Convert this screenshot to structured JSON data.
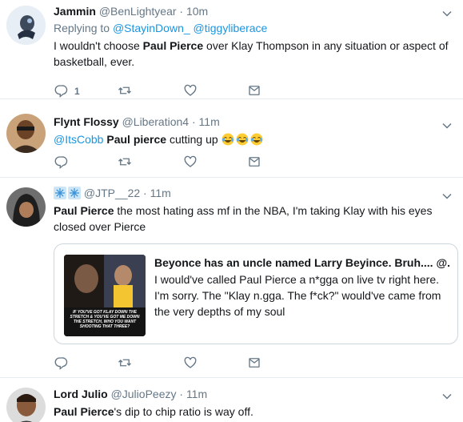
{
  "tweets": [
    {
      "name": "Jammin",
      "handle": "@BenLightyear",
      "time": "10m",
      "replying_prefix": "Replying to",
      "replying_to_1": "@StayinDown_",
      "replying_to_2": "@tiggyliberace",
      "text_before": "I wouldn't choose ",
      "text_bold": "Paul Pierce",
      "text_after": " over Klay Thompson in any situation or aspect of basketball, ever.",
      "reply_count": "1"
    },
    {
      "name": "Flynt Flossy",
      "handle": "@Liberation4",
      "time": "11m",
      "mention": "@ItsCobb",
      "text_bold": "Paul pierce",
      "text_after": " cutting up",
      "emojis": [
        "joy-emoji",
        "joy-emoji",
        "joy-emoji"
      ]
    },
    {
      "name": "",
      "handle": "@JTP__22",
      "time": "11m",
      "name_icons": [
        "snowflake-icon",
        "snowflake-icon"
      ],
      "text_bold": "Paul Pierce",
      "text_after": " the most hating ass mf in the NBA, I'm taking Klay with his eyes closed over Pierce",
      "quote": {
        "header": "Beyonce has an uncle named Larry Beyince. Bruh.... @...",
        "text": "I would've called Paul Pierce a n*gga  on live tv right here. I'm sorry. The \"Klay n.gga. The f*ck?\" would've came from the very depths of my soul",
        "image_caption": "IF YOU'VE GOT KLAY DOWN THE STRETCH & YOU'VE GOT ME DOWN THE STRETCH, WHO YOU WANT SHOOTING THAT THREE?"
      }
    },
    {
      "name": "Lord Julio",
      "handle": "@JulioPeezy",
      "time": "11m",
      "text_bold": "Paul Pierce",
      "text_after": "'s dip to chip ratio is way off."
    }
  ],
  "colors": {
    "link": "#1b95e0",
    "secondary_text": "#657786",
    "border": "#e6ecf0",
    "icon": "#657786"
  },
  "icons": {
    "reply": "reply-icon",
    "retweet": "retweet-icon",
    "like": "heart-icon",
    "dm": "envelope-icon",
    "caret": "chevron-down-icon"
  }
}
